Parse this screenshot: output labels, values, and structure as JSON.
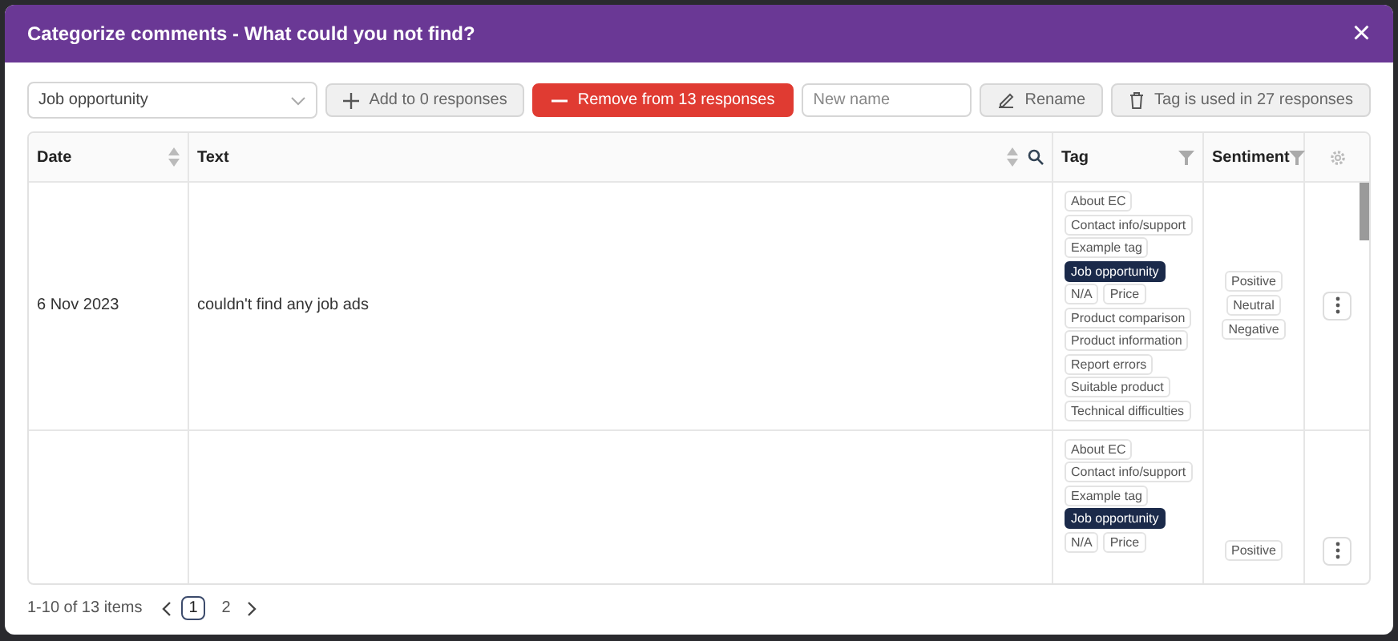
{
  "dialog": {
    "title": "Categorize comments - What could you not find?",
    "close": "×"
  },
  "toolbar": {
    "tag_select": "Job opportunity",
    "add_button": "Add to 0 responses",
    "remove_button": "Remove from 13 responses",
    "new_name": {
      "placeholder": "New name"
    },
    "rename_button": "Rename",
    "usage_button": "Tag is used in 27 responses"
  },
  "table": {
    "columns": [
      {
        "label": "Date",
        "kind": "sort"
      },
      {
        "label": "Text",
        "kind": "sortsearch"
      },
      {
        "label": "Tag",
        "kind": "filter"
      },
      {
        "label": "Sentiment",
        "kind": "filter"
      },
      {
        "kind": "settings"
      }
    ],
    "rows": [
      {
        "date": "6 Nov 2023",
        "text": "couldn't find any job ads",
        "tags": [
          {
            "label": "About EC",
            "selected": false
          },
          {
            "label": "Contact info/support",
            "selected": false
          },
          {
            "label": "Example tag",
            "selected": false
          },
          {
            "label": "Job opportunity",
            "selected": true
          },
          {
            "label": "N/A",
            "selected": false
          },
          {
            "label": "Price",
            "selected": false
          },
          {
            "label": "Product comparison",
            "selected": false
          },
          {
            "label": "Product information",
            "selected": false
          },
          {
            "label": "Report errors",
            "selected": false
          },
          {
            "label": "Suitable product",
            "selected": false
          },
          {
            "label": "Technical difficulties",
            "selected": false
          }
        ],
        "sentiments": [
          {
            "label": "Positive",
            "selected": false
          },
          {
            "label": "Neutral",
            "selected": false
          },
          {
            "label": "Negative",
            "selected": false
          }
        ]
      },
      {
        "tags": [
          {
            "label": "About EC",
            "selected": false
          },
          {
            "label": "Contact info/support",
            "selected": false
          },
          {
            "label": "Example tag",
            "selected": false
          },
          {
            "label": "Job opportunity",
            "selected": true
          },
          {
            "label": "N/A",
            "selected": false
          },
          {
            "label": "Price",
            "selected": false
          }
        ],
        "sentiments": [
          {
            "label": "Positive",
            "selected": false
          }
        ]
      }
    ]
  },
  "pagination": {
    "summary": "1-10 of 13 items",
    "pages": [
      {
        "label": "1",
        "selected": true
      },
      {
        "label": "2",
        "selected": false
      }
    ]
  }
}
